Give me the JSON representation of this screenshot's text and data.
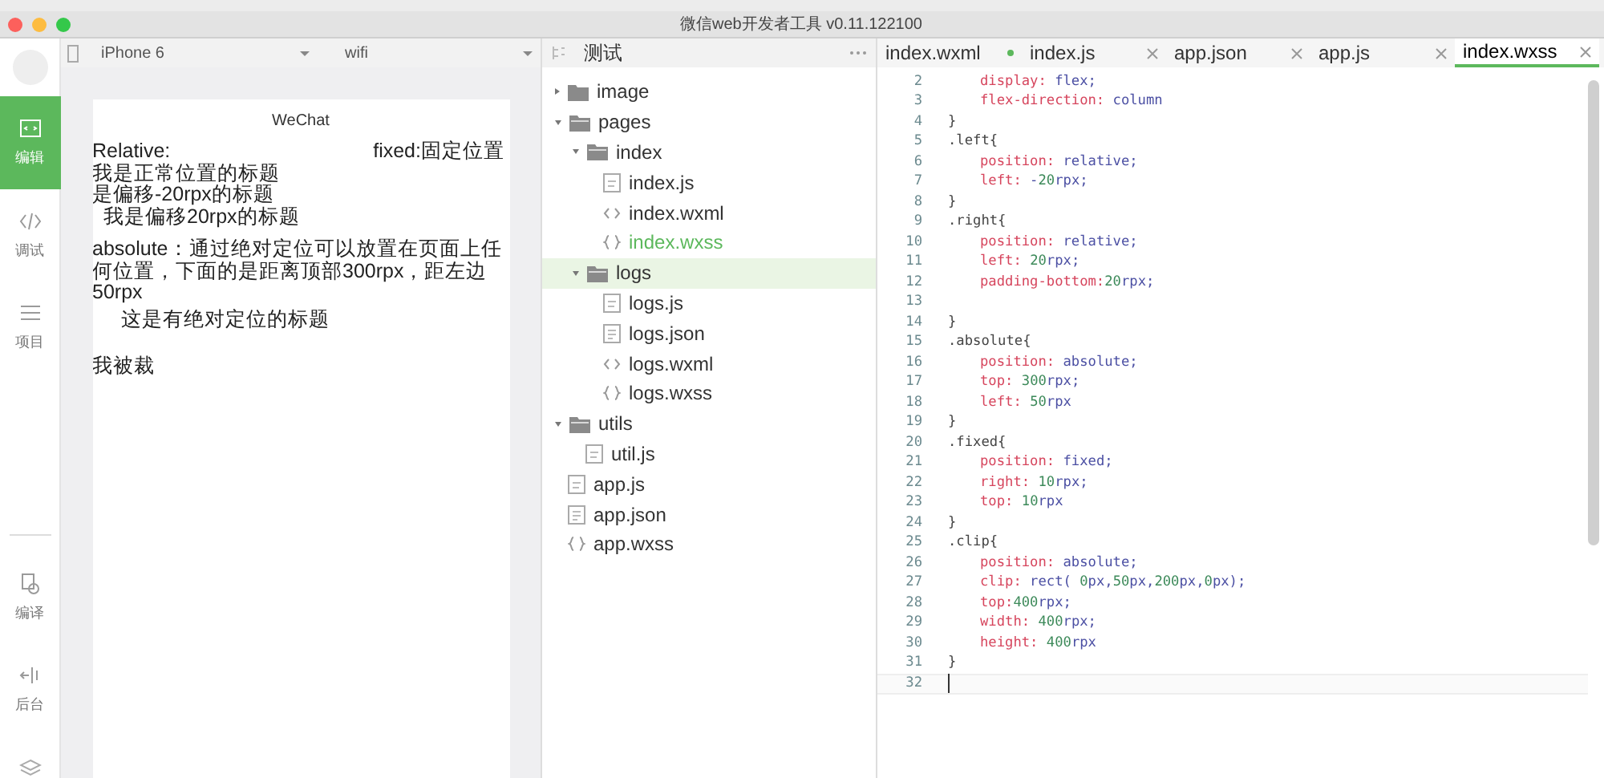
{
  "window": {
    "title": "微信web开发者工具 v0.11.122100"
  },
  "activity_bar": [
    {
      "label": "编辑",
      "kind": "edit",
      "selected": true
    },
    {
      "label": "调试",
      "kind": "debug",
      "selected": false
    },
    {
      "label": "项目",
      "kind": "project",
      "selected": false
    },
    {
      "label": "编译",
      "kind": "compile",
      "selected": false
    },
    {
      "label": "后台",
      "kind": "backend",
      "selected": false
    }
  ],
  "simulator": {
    "device": "iPhone 6",
    "network": "wifi",
    "nav_title": "WeChat",
    "content": [
      {
        "kind": "plain",
        "text": "Relative:"
      },
      {
        "kind": "fixed",
        "text": "fixed:固定位置"
      },
      {
        "kind": "plain",
        "text": "我是正常位置的标题"
      },
      {
        "kind": "left",
        "text": "是偏移-20rpx的标题"
      },
      {
        "kind": "right",
        "text": "我是偏移20rpx的标题"
      },
      {
        "kind": "plain",
        "text": "absolute：通过绝对定位可以放置在页面上任何位置，下面的是距离顶部300rpx，距左边50rpx"
      },
      {
        "kind": "absolute",
        "text": "这是有绝对定位的标题"
      },
      {
        "kind": "clip",
        "text": "我被裁"
      }
    ]
  },
  "project": {
    "name": "测试",
    "tree": [
      {
        "label": "image",
        "kind": "folder",
        "expanded": false,
        "selected": false,
        "active": false
      },
      {
        "label": "pages",
        "kind": "folder",
        "expanded": true,
        "selected": false,
        "active": false,
        "children": [
          {
            "label": "index",
            "kind": "folder",
            "expanded": true,
            "selected": false,
            "active": false,
            "children": [
              {
                "label": "index.js",
                "kind": "script",
                "selected": false,
                "active": false
              },
              {
                "label": "index.wxml",
                "kind": "markup",
                "selected": false,
                "active": false
              },
              {
                "label": "index.wxss",
                "kind": "style",
                "selected": false,
                "active": true
              }
            ]
          },
          {
            "label": "logs",
            "kind": "folder",
            "expanded": true,
            "selected": true,
            "active": false,
            "children": [
              {
                "label": "logs.js",
                "kind": "script",
                "selected": false,
                "active": false
              },
              {
                "label": "logs.json",
                "kind": "data",
                "selected": false,
                "active": false
              },
              {
                "label": "logs.wxml",
                "kind": "markup",
                "selected": false,
                "active": false
              },
              {
                "label": "logs.wxss",
                "kind": "style",
                "selected": false,
                "active": false
              }
            ]
          }
        ]
      },
      {
        "label": "utils",
        "kind": "folder",
        "expanded": true,
        "selected": false,
        "active": false,
        "children": [
          {
            "label": "util.js",
            "kind": "script",
            "selected": false,
            "active": false
          }
        ]
      },
      {
        "label": "app.js",
        "kind": "script",
        "selected": false,
        "active": false
      },
      {
        "label": "app.json",
        "kind": "data",
        "selected": false,
        "active": false
      },
      {
        "label": "app.wxss",
        "kind": "style",
        "selected": false,
        "active": false
      }
    ]
  },
  "editor": {
    "tabs": [
      {
        "label": "index.wxml",
        "selected": false,
        "modified": true
      },
      {
        "label": "index.js",
        "selected": false,
        "modified": false
      },
      {
        "label": "app.json",
        "selected": false,
        "modified": false
      },
      {
        "label": "app.js",
        "selected": false,
        "modified": false
      },
      {
        "label": "index.wxss",
        "selected": true,
        "modified": false
      }
    ],
    "lines": [
      {
        "number": "2",
        "prop": "display:",
        "value": " flex;"
      },
      {
        "number": "3",
        "prop": "flex-direction:",
        "value": " column"
      },
      {
        "number": "4",
        "text": "}"
      },
      {
        "number": "5",
        "text": ".left{"
      },
      {
        "number": "6",
        "prop": "position:",
        "value": " relative;"
      },
      {
        "number": "7",
        "prop": "left:",
        "value": " -20rpx;"
      },
      {
        "number": "8",
        "text": "}"
      },
      {
        "number": "9",
        "text": ".right{"
      },
      {
        "number": "10",
        "prop": "position:",
        "value": " relative;"
      },
      {
        "number": "11",
        "prop": "left:",
        "value": " 20rpx;"
      },
      {
        "number": "12",
        "prop": "padding-bottom:",
        "value": "20rpx;"
      },
      {
        "number": "13"
      },
      {
        "number": "14",
        "text": "}"
      },
      {
        "number": "15",
        "text": ".absolute{"
      },
      {
        "number": "16",
        "prop": "position:",
        "value": " absolute;"
      },
      {
        "number": "17",
        "prop": "top:",
        "value": " 300rpx;"
      },
      {
        "number": "18",
        "prop": "left:",
        "value": " 50rpx"
      },
      {
        "number": "19",
        "text": "}"
      },
      {
        "number": "20",
        "text": ".fixed{"
      },
      {
        "number": "21",
        "prop": "position:",
        "value": " fixed;"
      },
      {
        "number": "22",
        "prop": "right:",
        "value": " 10rpx;"
      },
      {
        "number": "23",
        "prop": "top:",
        "value": " 10rpx"
      },
      {
        "number": "24",
        "text": "}"
      },
      {
        "number": "25",
        "text": ".clip{"
      },
      {
        "number": "26",
        "prop": "position:",
        "value": " absolute;"
      },
      {
        "number": "27",
        "prop": "clip:",
        "value": " rect( 0px,50px,200px,0px);"
      },
      {
        "number": "28",
        "prop": "top:",
        "value": "400rpx;"
      },
      {
        "number": "29",
        "prop": "width:",
        "value": " 400rpx;"
      },
      {
        "number": "30",
        "prop": "height:",
        "value": " 400rpx"
      },
      {
        "number": "31",
        "text": "}"
      },
      {
        "number": "32",
        "current": true
      }
    ]
  }
}
